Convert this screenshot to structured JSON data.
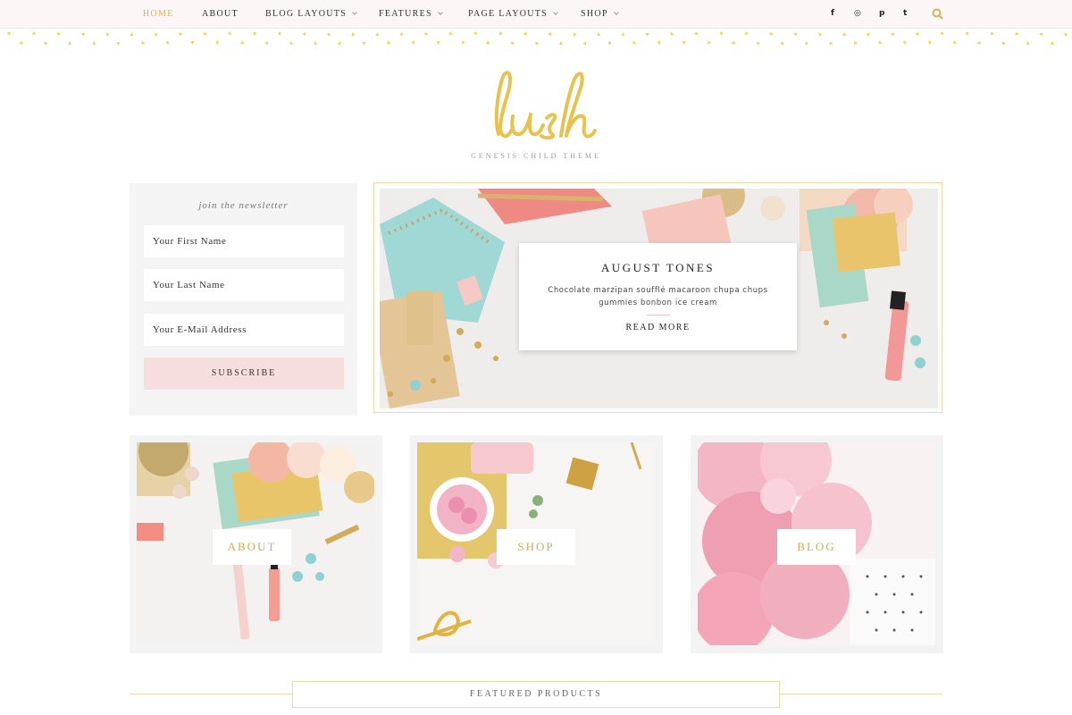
{
  "nav": {
    "items": [
      {
        "label": "Home",
        "active": true
      },
      {
        "label": "About"
      },
      {
        "label": "Blog Layouts",
        "dropdown": true
      },
      {
        "label": "Features",
        "dropdown": true
      },
      {
        "label": "Page Layouts",
        "dropdown": true
      },
      {
        "label": "Shop",
        "dropdown": true
      }
    ],
    "social": [
      {
        "icon": "facebook-icon",
        "glyph": "f"
      },
      {
        "icon": "instagram-icon",
        "glyph": "◎"
      },
      {
        "icon": "pinterest-icon",
        "glyph": "p"
      },
      {
        "icon": "twitter-icon",
        "glyph": "t"
      }
    ],
    "search_icon": "search-icon"
  },
  "branding": {
    "logo_text": "lush",
    "tagline": "Genesis Child Theme",
    "accent_color": "#e8c24e"
  },
  "newsletter": {
    "title": "join the newsletter",
    "first_name_placeholder": "Your First Name",
    "last_name_placeholder": "Your Last Name",
    "email_placeholder": "Your E-Mail Address",
    "submit_label": "Subscribe"
  },
  "slider": {
    "title": "August Tones",
    "text": "Chocolate marzipan soufflé macaroon chupa chups gummies bonbon ice cream",
    "cta": "Read More"
  },
  "tiles": [
    {
      "label": "About"
    },
    {
      "label": "Shop"
    },
    {
      "label": "Blog"
    }
  ],
  "featured": {
    "label": "Featured Products"
  },
  "colors": {
    "gold": "#d4b25a",
    "pink": "#f7dede",
    "panel": "#f4f4f4"
  }
}
